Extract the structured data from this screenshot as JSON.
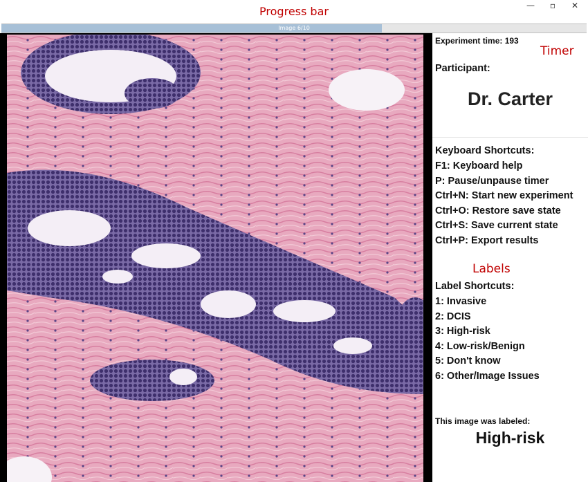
{
  "annotations": {
    "progress_bar": "Progress bar",
    "timer": "Timer",
    "labels": "Labels"
  },
  "window": {
    "minimize": "—",
    "maximize": "▫",
    "close": "✕"
  },
  "progress": {
    "text": "Image 6/10",
    "current": 6,
    "total": 10,
    "fraction": 0.65,
    "fill_color": "#a7c0d7"
  },
  "image": {
    "description": "histopathology-tissue"
  },
  "panel": {
    "experiment_time_label": "Experiment time: 193",
    "participant_label": "Participant:",
    "participant_name": "Dr. Carter",
    "keyboard_title": "Keyboard Shortcuts:",
    "keyboard_shortcuts": [
      "F1: Keyboard help",
      "P: Pause/unpause timer",
      "Ctrl+N: Start new experiment",
      "Ctrl+O: Restore save state",
      "Ctrl+S: Save current state",
      "Ctrl+P: Export results"
    ],
    "label_title": "Label Shortcuts:",
    "label_shortcuts": [
      "1: Invasive",
      "2: DCIS",
      "3: High-risk",
      "4: Low-risk/Benign",
      "5: Don't know",
      "6: Other/Image Issues"
    ],
    "labeled_caption": "This image was labeled:",
    "labeled_value": "High-risk"
  },
  "colors": {
    "annotation": "#c00000",
    "tissue_pink": "#e9a3b8",
    "nuclei_purple": "#4b3a7a"
  }
}
